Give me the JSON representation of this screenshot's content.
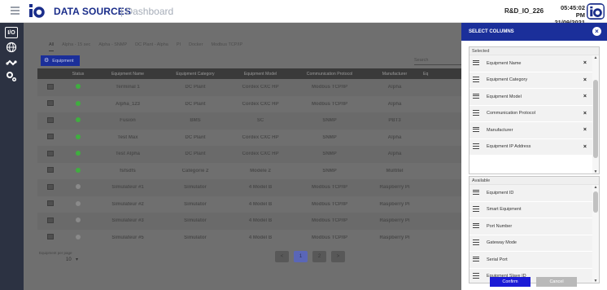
{
  "header": {
    "app_title": "DATA SOURCES",
    "page_title": "| Dashboard",
    "user": "R&D_IO_226",
    "time": "05:45:02 PM",
    "date": "21/09/2021",
    "brand_color": "#1a2d8a"
  },
  "rail": {
    "io_label": "I/O",
    "items": [
      "io-icon",
      "globe-icon",
      "network-icon",
      "settings-icon"
    ]
  },
  "main": {
    "tabs": [
      "All",
      "Alpha - 15 sec",
      "Alpha - SNMP",
      "DC Plant - Alpha",
      "PI",
      "Docker",
      "Modbus TCP/IP"
    ],
    "active_tab": "All",
    "equipment_button": "Equipment",
    "search_placeholder": "Search",
    "columns": [
      "",
      "Status",
      "Equipment Name",
      "Equipment Category",
      "Equipment Model",
      "Communication Protocol",
      "Manufacturer",
      "Eq"
    ],
    "rows": [
      {
        "status": "green",
        "name": "Terminal 1",
        "category": "DC Plant",
        "model": "Cordex CXC HP",
        "protocol": "Modbus TCP/IP",
        "manufacturer": "Alpha"
      },
      {
        "status": "green",
        "name": "Alpha_123",
        "category": "DC Plant",
        "model": "Cordex CXC HP",
        "protocol": "Modbus TCP/IP",
        "manufacturer": "Alpha"
      },
      {
        "status": "green",
        "name": "Fusion",
        "category": "BMS",
        "model": "SC",
        "protocol": "SNMP",
        "manufacturer": "PBT3"
      },
      {
        "status": "green",
        "name": "Test Max",
        "category": "DC Plant",
        "model": "Cordex CXC HP",
        "protocol": "SNMP",
        "manufacturer": "Alpha"
      },
      {
        "status": "green",
        "name": "Test Alpha",
        "category": "DC Plant",
        "model": "Cordex CXC HP",
        "protocol": "SNMP",
        "manufacturer": "Alpha"
      },
      {
        "status": "green",
        "name": "fsfsdfs",
        "category": "Catégorie 2",
        "model": "Modèle 2",
        "protocol": "SNMP",
        "manufacturer": "Multitel"
      },
      {
        "status": "grey",
        "name": "Simulateur #1",
        "category": "Simulator",
        "model": "4 Model B",
        "protocol": "Modbus TCP/IP",
        "manufacturer": "Raspberry Pi"
      },
      {
        "status": "grey",
        "name": "Simulateur #2",
        "category": "Simulator",
        "model": "4 Model B",
        "protocol": "Modbus TCP/IP",
        "manufacturer": "Raspberry Pi"
      },
      {
        "status": "grey",
        "name": "Simulateur #3",
        "category": "Simulator",
        "model": "4 Model B",
        "protocol": "Modbus TCP/IP",
        "manufacturer": "Raspberry Pi"
      },
      {
        "status": "grey",
        "name": "Simulateur #5",
        "category": "Simulator",
        "model": "4 Model B",
        "protocol": "Modbus TCP/IP",
        "manufacturer": "Raspberry Pi"
      }
    ],
    "status_colors": {
      "green": "#3fae3f",
      "grey": "#8a8a8a"
    },
    "per_page_label": "Equipment per page",
    "per_page_value": "10",
    "pagination": [
      "<",
      "1",
      "2",
      ">"
    ],
    "current_page": "1"
  },
  "panel": {
    "title": "SELECT COLUMNS",
    "selected_label": "Selected",
    "selected": [
      "Equipment Name",
      "Equipment Category",
      "Equipment Model",
      "Communication Protocol",
      "Manufacturer",
      "Equipment IP Address"
    ],
    "available_label": "Available",
    "available": [
      "Equipment ID",
      "Smart Equipment",
      "Port Number",
      "Gateway Mode",
      "Serial Port",
      "Equipment Slave ID"
    ],
    "confirm": "Confirm",
    "cancel": "Cancel",
    "accent_color": "#1b2f9a"
  }
}
